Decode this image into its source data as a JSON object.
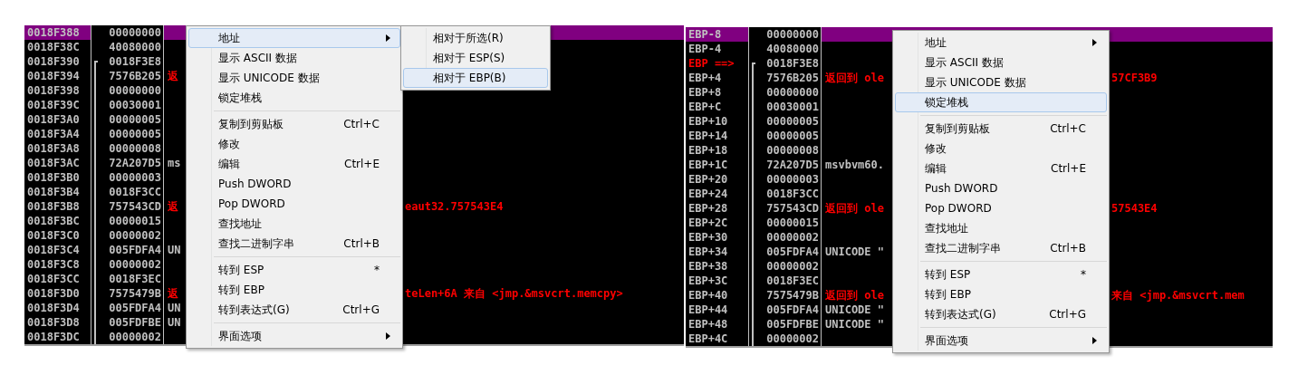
{
  "panes": [
    {
      "kind": "absolute",
      "rows": [
        {
          "address": "0018F388",
          "value": "00000000",
          "selected": true,
          "current": false,
          "frame_start": false,
          "in_frame": false,
          "kind": "plain"
        },
        {
          "address": "0018F38C",
          "value": "40080000",
          "selected": false,
          "current": false,
          "frame_start": false,
          "in_frame": false,
          "kind": "plain"
        },
        {
          "address": "0018F390",
          "value": "0018F3E8",
          "selected": false,
          "current": false,
          "frame_start": true,
          "in_frame": true,
          "kind": "plain"
        },
        {
          "address": "0018F394",
          "value": "7576B205",
          "selected": false,
          "current": false,
          "frame_start": false,
          "in_frame": true,
          "kind": "return",
          "comment_left": "返"
        },
        {
          "address": "0018F398",
          "value": "00000000",
          "selected": false,
          "current": false,
          "frame_start": false,
          "in_frame": true,
          "kind": "plain"
        },
        {
          "address": "0018F39C",
          "value": "00030001",
          "selected": false,
          "current": false,
          "frame_start": false,
          "in_frame": true,
          "kind": "plain"
        },
        {
          "address": "0018F3A0",
          "value": "00000005",
          "selected": false,
          "current": false,
          "frame_start": false,
          "in_frame": true,
          "kind": "plain"
        },
        {
          "address": "0018F3A4",
          "value": "00000005",
          "selected": false,
          "current": false,
          "frame_start": false,
          "in_frame": true,
          "kind": "plain"
        },
        {
          "address": "0018F3A8",
          "value": "00000008",
          "selected": false,
          "current": false,
          "frame_start": false,
          "in_frame": true,
          "kind": "plain"
        },
        {
          "address": "0018F3AC",
          "value": "72A207D5",
          "selected": false,
          "current": false,
          "frame_start": false,
          "in_frame": true,
          "kind": "plain",
          "comment_left": "ms"
        },
        {
          "address": "0018F3B0",
          "value": "00000003",
          "selected": false,
          "current": false,
          "frame_start": false,
          "in_frame": true,
          "kind": "plain"
        },
        {
          "address": "0018F3B4",
          "value": "0018F3CC",
          "selected": false,
          "current": false,
          "frame_start": false,
          "in_frame": true,
          "kind": "plain"
        },
        {
          "address": "0018F3B8",
          "value": "757543CD",
          "selected": false,
          "current": false,
          "frame_start": false,
          "in_frame": true,
          "kind": "return",
          "comment_left": "返",
          "comment_right": "eaut32.757543E4"
        },
        {
          "address": "0018F3BC",
          "value": "00000015",
          "selected": false,
          "current": false,
          "frame_start": false,
          "in_frame": true,
          "kind": "plain"
        },
        {
          "address": "0018F3C0",
          "value": "00000002",
          "selected": false,
          "current": false,
          "frame_start": false,
          "in_frame": true,
          "kind": "plain"
        },
        {
          "address": "0018F3C4",
          "value": "005FDFA4",
          "selected": false,
          "current": false,
          "frame_start": false,
          "in_frame": true,
          "kind": "plain",
          "comment_left": "UN"
        },
        {
          "address": "0018F3C8",
          "value": "00000002",
          "selected": false,
          "current": false,
          "frame_start": false,
          "in_frame": true,
          "kind": "plain"
        },
        {
          "address": "0018F3CC",
          "value": "0018F3EC",
          "selected": false,
          "current": false,
          "frame_start": false,
          "in_frame": true,
          "kind": "plain"
        },
        {
          "address": "0018F3D0",
          "value": "7575479B",
          "selected": false,
          "current": false,
          "frame_start": false,
          "in_frame": true,
          "kind": "return",
          "comment_left": "返",
          "comment_right": "teLen+6A 来自 <jmp.&msvcrt.memcpy>"
        },
        {
          "address": "0018F3D4",
          "value": "005FDFA4",
          "selected": false,
          "current": false,
          "frame_start": false,
          "in_frame": true,
          "kind": "plain",
          "comment_left": "UN"
        },
        {
          "address": "0018F3D8",
          "value": "005FDFBE",
          "selected": false,
          "current": false,
          "frame_start": false,
          "in_frame": true,
          "kind": "plain",
          "comment_left": "UN"
        },
        {
          "address": "0018F3DC",
          "value": "00000002",
          "selected": false,
          "current": false,
          "frame_start": false,
          "in_frame": true,
          "kind": "plain"
        }
      ],
      "menu": {
        "items": [
          {
            "kind": "item",
            "label": "地址",
            "has_submenu": true,
            "selected": true
          },
          {
            "kind": "item",
            "label": "显示 ASCII 数据",
            "has_submenu": false,
            "selected": false
          },
          {
            "kind": "item",
            "label": "显示 UNICODE 数据",
            "has_submenu": false,
            "selected": false
          },
          {
            "kind": "item",
            "label": "锁定堆栈",
            "has_submenu": false,
            "selected": false
          },
          {
            "kind": "separator"
          },
          {
            "kind": "item",
            "label": "复制到剪贴板",
            "shortcut": "Ctrl+C",
            "has_submenu": false,
            "selected": false
          },
          {
            "kind": "item",
            "label": "修改",
            "has_submenu": false,
            "selected": false
          },
          {
            "kind": "item",
            "label": "编辑",
            "shortcut": "Ctrl+E",
            "has_submenu": false,
            "selected": false
          },
          {
            "kind": "item",
            "label": "Push DWORD",
            "has_submenu": false,
            "selected": false
          },
          {
            "kind": "item",
            "label": "Pop DWORD",
            "has_submenu": false,
            "selected": false
          },
          {
            "kind": "item",
            "label": "查找地址",
            "has_submenu": false,
            "selected": false
          },
          {
            "kind": "item",
            "label": "查找二进制字串",
            "shortcut": "Ctrl+B",
            "has_submenu": false,
            "selected": false
          },
          {
            "kind": "separator"
          },
          {
            "kind": "item",
            "label": "转到 ESP",
            "shortcut": "*",
            "has_submenu": false,
            "selected": false
          },
          {
            "kind": "item",
            "label": "转到 EBP",
            "has_submenu": false,
            "selected": false
          },
          {
            "kind": "item",
            "label": "转到表达式(G)",
            "shortcut": "Ctrl+G",
            "has_submenu": false,
            "selected": false
          },
          {
            "kind": "separator"
          },
          {
            "kind": "item",
            "label": "界面选项",
            "has_submenu": true,
            "selected": false
          }
        ]
      },
      "submenu": {
        "items": [
          {
            "kind": "item",
            "label": "相对于所选(R)",
            "has_submenu": false,
            "selected": false
          },
          {
            "kind": "item",
            "label": "相对于 ESP(S)",
            "has_submenu": false,
            "selected": false
          },
          {
            "kind": "item",
            "label": "相对于 EBP(B)",
            "has_submenu": false,
            "selected": true
          }
        ]
      }
    },
    {
      "kind": "relative",
      "rows": [
        {
          "address": "EBP-8",
          "value": "00000000",
          "selected": true,
          "current": false,
          "frame_start": false,
          "in_frame": false,
          "kind": "plain"
        },
        {
          "address": "EBP-4",
          "value": "40080000",
          "selected": false,
          "current": false,
          "frame_start": false,
          "in_frame": false,
          "kind": "plain"
        },
        {
          "address": "EBP ==>",
          "value": "0018F3E8",
          "selected": false,
          "current": true,
          "frame_start": true,
          "in_frame": true,
          "kind": "plain"
        },
        {
          "address": "EBP+4",
          "value": "7576B205",
          "selected": false,
          "current": false,
          "frame_start": false,
          "in_frame": true,
          "kind": "return",
          "comment_left": "返回到 ole",
          "comment_right": "57CF3B9"
        },
        {
          "address": "EBP+8",
          "value": "00000000",
          "selected": false,
          "current": false,
          "frame_start": false,
          "in_frame": true,
          "kind": "plain"
        },
        {
          "address": "EBP+C",
          "value": "00030001",
          "selected": false,
          "current": false,
          "frame_start": false,
          "in_frame": true,
          "kind": "plain"
        },
        {
          "address": "EBP+10",
          "value": "00000005",
          "selected": false,
          "current": false,
          "frame_start": false,
          "in_frame": true,
          "kind": "plain"
        },
        {
          "address": "EBP+14",
          "value": "00000005",
          "selected": false,
          "current": false,
          "frame_start": false,
          "in_frame": true,
          "kind": "plain"
        },
        {
          "address": "EBP+18",
          "value": "00000008",
          "selected": false,
          "current": false,
          "frame_start": false,
          "in_frame": true,
          "kind": "plain"
        },
        {
          "address": "EBP+1C",
          "value": "72A207D5",
          "selected": false,
          "current": false,
          "frame_start": false,
          "in_frame": true,
          "kind": "plain",
          "comment_left": "msvbvm60."
        },
        {
          "address": "EBP+20",
          "value": "00000003",
          "selected": false,
          "current": false,
          "frame_start": false,
          "in_frame": true,
          "kind": "plain"
        },
        {
          "address": "EBP+24",
          "value": "0018F3CC",
          "selected": false,
          "current": false,
          "frame_start": false,
          "in_frame": true,
          "kind": "plain"
        },
        {
          "address": "EBP+28",
          "value": "757543CD",
          "selected": false,
          "current": false,
          "frame_start": false,
          "in_frame": true,
          "kind": "return",
          "comment_left": "返回到 ole",
          "comment_right": "57543E4"
        },
        {
          "address": "EBP+2C",
          "value": "00000015",
          "selected": false,
          "current": false,
          "frame_start": false,
          "in_frame": true,
          "kind": "plain"
        },
        {
          "address": "EBP+30",
          "value": "00000002",
          "selected": false,
          "current": false,
          "frame_start": false,
          "in_frame": true,
          "kind": "plain"
        },
        {
          "address": "EBP+34",
          "value": "005FDFA4",
          "selected": false,
          "current": false,
          "frame_start": false,
          "in_frame": true,
          "kind": "plain",
          "comment_left": "UNICODE \""
        },
        {
          "address": "EBP+38",
          "value": "00000002",
          "selected": false,
          "current": false,
          "frame_start": false,
          "in_frame": true,
          "kind": "plain"
        },
        {
          "address": "EBP+3C",
          "value": "0018F3EC",
          "selected": false,
          "current": false,
          "frame_start": false,
          "in_frame": true,
          "kind": "plain"
        },
        {
          "address": "EBP+40",
          "value": "7575479B",
          "selected": false,
          "current": false,
          "frame_start": false,
          "in_frame": true,
          "kind": "return",
          "comment_left": "返回到 ole",
          "comment_right": "来自 <jmp.&msvcrt.mem"
        },
        {
          "address": "EBP+44",
          "value": "005FDFA4",
          "selected": false,
          "current": false,
          "frame_start": false,
          "in_frame": true,
          "kind": "plain",
          "comment_left": "UNICODE \""
        },
        {
          "address": "EBP+48",
          "value": "005FDFBE",
          "selected": false,
          "current": false,
          "frame_start": false,
          "in_frame": true,
          "kind": "plain",
          "comment_left": "UNICODE \""
        },
        {
          "address": "EBP+4C",
          "value": "00000002",
          "selected": false,
          "current": false,
          "frame_start": false,
          "in_frame": true,
          "kind": "plain"
        }
      ],
      "menu": {
        "items": [
          {
            "kind": "item",
            "label": "地址",
            "has_submenu": true,
            "selected": false
          },
          {
            "kind": "item",
            "label": "显示 ASCII 数据",
            "has_submenu": false,
            "selected": false
          },
          {
            "kind": "item",
            "label": "显示 UNICODE 数据",
            "has_submenu": false,
            "selected": false
          },
          {
            "kind": "item",
            "label": "锁定堆栈",
            "has_submenu": false,
            "selected": true
          },
          {
            "kind": "separator"
          },
          {
            "kind": "item",
            "label": "复制到剪贴板",
            "shortcut": "Ctrl+C",
            "has_submenu": false,
            "selected": false
          },
          {
            "kind": "item",
            "label": "修改",
            "has_submenu": false,
            "selected": false
          },
          {
            "kind": "item",
            "label": "编辑",
            "shortcut": "Ctrl+E",
            "has_submenu": false,
            "selected": false
          },
          {
            "kind": "item",
            "label": "Push DWORD",
            "has_submenu": false,
            "selected": false
          },
          {
            "kind": "item",
            "label": "Pop DWORD",
            "has_submenu": false,
            "selected": false
          },
          {
            "kind": "item",
            "label": "查找地址",
            "has_submenu": false,
            "selected": false
          },
          {
            "kind": "item",
            "label": "查找二进制字串",
            "shortcut": "Ctrl+B",
            "has_submenu": false,
            "selected": false
          },
          {
            "kind": "separator"
          },
          {
            "kind": "item",
            "label": "转到 ESP",
            "shortcut": "*",
            "has_submenu": false,
            "selected": false
          },
          {
            "kind": "item",
            "label": "转到 EBP",
            "has_submenu": false,
            "selected": false
          },
          {
            "kind": "item",
            "label": "转到表达式(G)",
            "shortcut": "Ctrl+G",
            "has_submenu": false,
            "selected": false
          },
          {
            "kind": "separator"
          },
          {
            "kind": "item",
            "label": "界面选项",
            "has_submenu": true,
            "selected": false
          }
        ]
      }
    }
  ]
}
